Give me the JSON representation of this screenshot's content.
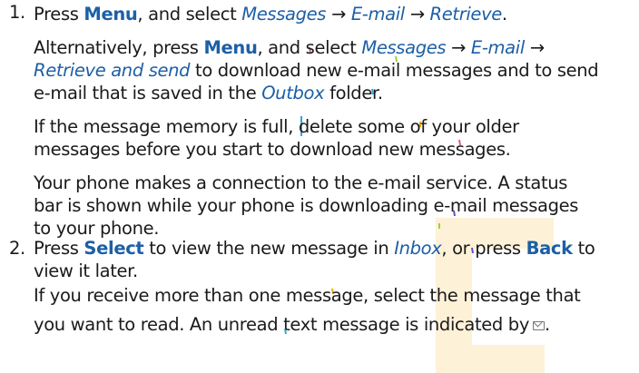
{
  "colors": {
    "text": "#1a1a1a",
    "accent": "#1d5fa6"
  },
  "step1": {
    "number": "1.",
    "line1": {
      "a": "Press ",
      "menu": "Menu",
      "b": ", and select ",
      "messages": "Messages",
      "arrow1": " → ",
      "email": "E-mail",
      "arrow2": " → ",
      "retrieve": "Retrieve",
      "end": "."
    },
    "alt1": {
      "a": "Alternatively, press ",
      "menu": "Menu",
      "b": ", and select ",
      "messages": "Messages",
      "arrow1": " → ",
      "email": "E-mail",
      "arrow2": " →"
    },
    "alt2": {
      "retrieve_send": "Retrieve and send",
      "rest": " to download new e-mail messages and to send"
    },
    "alt3": {
      "a": "e-mail that is saved in the ",
      "outbox": "Outbox",
      "b": " folder."
    },
    "mem1": "If the message memory is full, delete some of your older",
    "mem2": "messages before you start to download new messages.",
    "conn1": "Your phone makes a connection to the e-mail service. A status",
    "conn2": "bar is shown while your phone is downloading e-mail messages",
    "conn3": "to your phone."
  },
  "step2": {
    "number": "2.",
    "line1": {
      "a": "Press ",
      "select": "Select",
      "b": " to view the new message in ",
      "inbox": "Inbox",
      "c": ", or press ",
      "back": "Back",
      "d": " to"
    },
    "line2": "view it later.",
    "line3": "If you receive more than one message, select the message that",
    "line4": "you want to read. An unread text message is indicated by",
    "icon": "envelope-icon",
    "line4_end": "."
  }
}
